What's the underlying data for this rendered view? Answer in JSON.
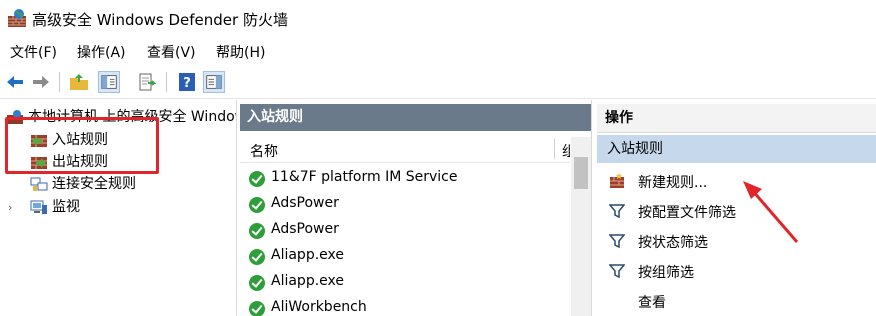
{
  "window": {
    "title": "高级安全 Windows Defender 防火墙"
  },
  "menubar": {
    "items": [
      "文件(F)",
      "操作(A)",
      "查看(V)",
      "帮助(H)"
    ]
  },
  "tree": {
    "root": "本地计算机 上的高级安全 Windows Defender 防火墙",
    "items": [
      "入站规则",
      "出站规则",
      "连接安全规则",
      "监视"
    ]
  },
  "center": {
    "header": "入站规则",
    "columns": [
      "名称",
      "组"
    ],
    "rows": [
      "11&7F platform IM Service",
      "AdsPower",
      "AdsPower",
      "Aliapp.exe",
      "Aliapp.exe",
      "AliWorkbench"
    ]
  },
  "actions": {
    "header": "操作",
    "subheader": "入站规则",
    "items": [
      "新建规则...",
      "按配置文件筛选",
      "按状态筛选",
      "按组筛选",
      "查看"
    ]
  },
  "colors": {
    "annotation": "#e0262a",
    "header_bg": "#6b7a8b",
    "selected_bg": "#c5d8ec",
    "allow_icon": "#2e9e3b"
  }
}
